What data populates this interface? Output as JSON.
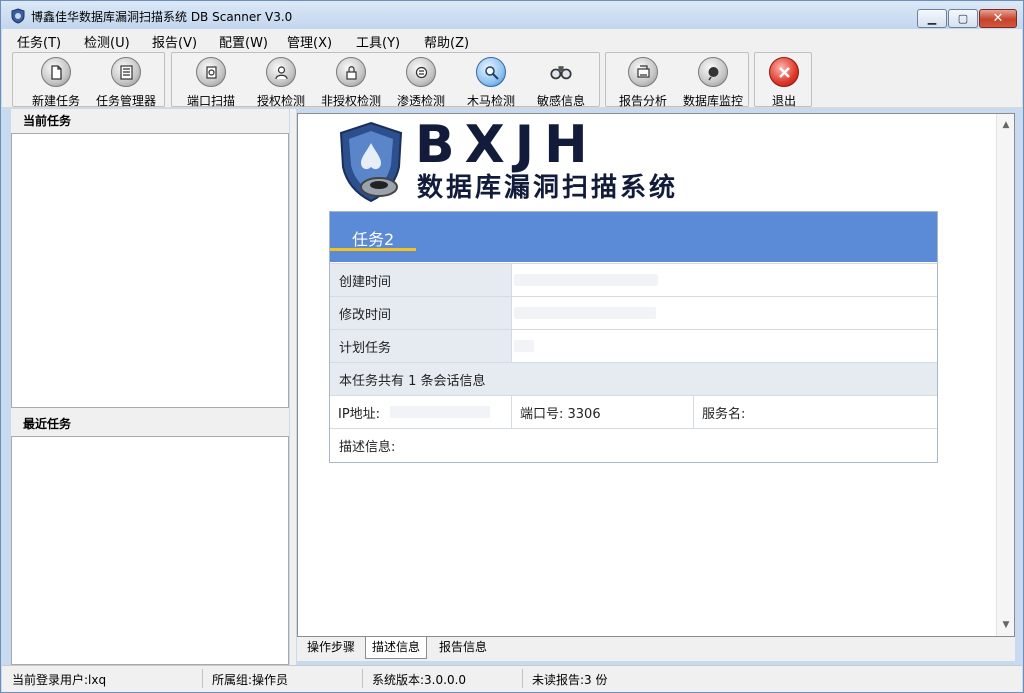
{
  "window": {
    "title": "博鑫佳华数据库漏洞扫描系统 DB Scanner V3.0"
  },
  "menu": [
    "任务(T)",
    "检测(U)",
    "报告(V)",
    "配置(W)",
    "管理(X)",
    "工具(Y)",
    "帮助(Z)"
  ],
  "toolbar": {
    "new_task": "新建任务",
    "task_manager": "任务管理器",
    "port_scan": "端口扫描",
    "auth_check": "授权检测",
    "unauth_check": "非授权检测",
    "pentest": "渗透检测",
    "trojan_check": "木马检测",
    "sensitive_info": "敏感信息",
    "report_analysis": "报告分析",
    "db_monitor": "数据库监控",
    "exit": "退出"
  },
  "left": {
    "current_tasks": "当前任务",
    "recent_tasks": "最近任务"
  },
  "logo": {
    "main": "BXJH",
    "sub": "数据库漏洞扫描系统"
  },
  "task": {
    "name": "任务2",
    "created_label": "创建时间",
    "modified_label": "修改时间",
    "scheduled_label": "计划任务",
    "session_info": "本任务共有 1 条会话信息",
    "ip_label": "IP地址:",
    "port_label": "端口号: 3306",
    "service_label": "服务名:",
    "desc_label": "描述信息:"
  },
  "tabs": [
    "操作步骤",
    "描述信息",
    "报告信息"
  ],
  "status": {
    "user": "当前登录用户:lxq",
    "group": "所属组:操作员",
    "version": "系统版本:3.0.0.0",
    "unread": "未读报告:3 份"
  }
}
